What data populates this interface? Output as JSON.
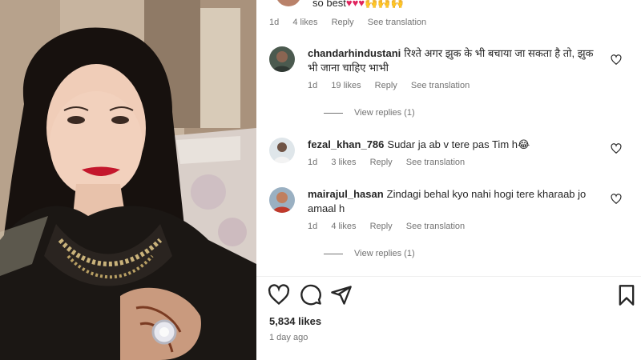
{
  "first_comment": {
    "text": "so best",
    "hearts": "♥♥♥",
    "hands": "🙌🙌🙌",
    "meta": {
      "time": "1d",
      "likes": "4 likes",
      "reply": "Reply",
      "translate": "See translation"
    }
  },
  "comments": [
    {
      "username": "chandarhindustani",
      "text": "रिश्ते अगर झुक के भी बचाया जा सकता है तो, झुक भी जाना चाहिए भाभी",
      "time": "1d",
      "likes": "19 likes",
      "reply": "Reply",
      "translate": "See translation",
      "view_replies": "View replies (1)"
    },
    {
      "username": "fezal_khan_786",
      "text": "Sudar ja ab v tere pas Tim h😂",
      "time": "1d",
      "likes": "3 likes",
      "reply": "Reply",
      "translate": "See translation"
    },
    {
      "username": "mairajul_hasan",
      "text": "Zindagi behal kyo nahi hogi tere kharaab jo amaal h",
      "time": "1d",
      "likes": "4 likes",
      "reply": "Reply",
      "translate": "See translation",
      "view_replies": "View replies (1)"
    }
  ],
  "actions": {
    "icons": [
      "heart-icon",
      "comment-icon",
      "share-icon",
      "bookmark-icon"
    ],
    "likes": "5,834 likes",
    "posted": "1 day ago"
  },
  "colors": {
    "heart": "#e0245e",
    "text": "#262626",
    "muted": "#737373",
    "lipstick": "#c4172c"
  }
}
